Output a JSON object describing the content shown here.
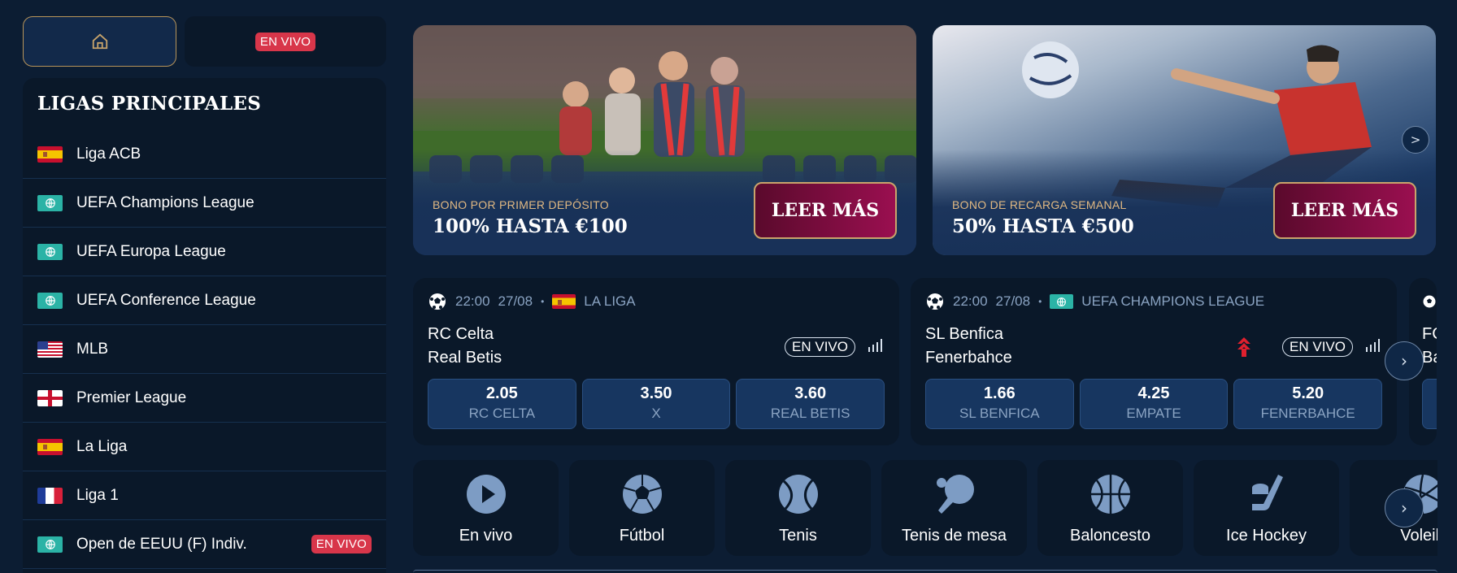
{
  "nav": {
    "home_icon": "home-icon",
    "live_badge": "EN VIVO"
  },
  "leagues": {
    "title": "LIGAS PRINCIPALES",
    "items": [
      {
        "name": "Liga ACB",
        "flag": "spain"
      },
      {
        "name": "UEFA Champions League",
        "flag": "world"
      },
      {
        "name": "UEFA Europa League",
        "flag": "world"
      },
      {
        "name": "UEFA Conference League",
        "flag": "world"
      },
      {
        "name": "MLB",
        "flag": "usa"
      },
      {
        "name": "Premier League",
        "flag": "england"
      },
      {
        "name": "La Liga",
        "flag": "spain"
      },
      {
        "name": "Liga 1",
        "flag": "france"
      },
      {
        "name": "Open de EEUU (F) Indiv.",
        "flag": "world",
        "badge": "EN VIVO"
      }
    ]
  },
  "banners": [
    {
      "kicker": "BONO POR PRIMER DEPÓSITO",
      "headline": "100% HASTA €100",
      "cta": "LEER MÁS"
    },
    {
      "kicker": "BONO DE RECARGA SEMANAL",
      "headline": "50% HASTA €500",
      "cta": "LEER MÁS"
    }
  ],
  "matches": [
    {
      "time": "22:00",
      "date": "27/08",
      "league": "LA LIGA",
      "home": "RC Celta",
      "away": "Real Betis",
      "live": "EN VIVO",
      "odds": [
        {
          "value": "2.05",
          "label": "RC CELTA"
        },
        {
          "value": "3.50",
          "label": "X"
        },
        {
          "value": "3.60",
          "label": "REAL BETIS"
        }
      ]
    },
    {
      "time": "22:00",
      "date": "27/08",
      "league": "UEFA CHAMPIONS LEAGUE",
      "home": "SL Benfica",
      "away": "Fenerbahce",
      "live": "EN VIVO",
      "odds": [
        {
          "value": "1.66",
          "label": "SL BENFICA"
        },
        {
          "value": "4.25",
          "label": "EMPATE"
        },
        {
          "value": "5.20",
          "label": "FENERBAHCE"
        }
      ]
    },
    {
      "home": "FC",
      "away": "Ba"
    }
  ],
  "sports": [
    {
      "label": "En vivo",
      "icon": "play-icon"
    },
    {
      "label": "Fútbol",
      "icon": "soccer-ball-icon"
    },
    {
      "label": "Tenis",
      "icon": "tennis-ball-icon"
    },
    {
      "label": "Tenis de mesa",
      "icon": "ping-pong-icon"
    },
    {
      "label": "Baloncesto",
      "icon": "basketball-icon"
    },
    {
      "label": "Ice Hockey",
      "icon": "hockey-icon"
    },
    {
      "label": "Voleib",
      "icon": "volleyball-icon"
    }
  ],
  "colors": {
    "background": "#0c1d33",
    "panel": "#0a1829",
    "odd_button": "#173660",
    "live_red": "#d8364a",
    "gold": "#c9a46b",
    "cta": "#9a0f50"
  }
}
